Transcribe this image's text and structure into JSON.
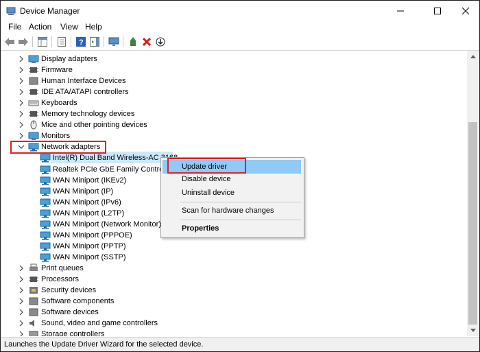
{
  "window": {
    "title": "Device Manager"
  },
  "menu": [
    "File",
    "Action",
    "View",
    "Help"
  ],
  "tree": {
    "categories": [
      {
        "label": "Display adapters",
        "icon": "display-adapter-icon"
      },
      {
        "label": "Firmware",
        "icon": "firmware-icon"
      },
      {
        "label": "Human Interface Devices",
        "icon": "hid-icon"
      },
      {
        "label": "IDE ATA/ATAPI controllers",
        "icon": "ide-controller-icon"
      },
      {
        "label": "Keyboards",
        "icon": "keyboard-icon"
      },
      {
        "label": "Memory technology devices",
        "icon": "memory-icon"
      },
      {
        "label": "Mice and other pointing devices",
        "icon": "mouse-icon"
      },
      {
        "label": "Monitors",
        "icon": "monitor-icon"
      },
      {
        "label": "Network adapters",
        "icon": "network-adapter-icon",
        "expanded": true
      }
    ],
    "network_children": [
      "Intel(R) Dual Band Wireless-AC 3168",
      "Realtek PCIe GbE Family Controller",
      "WAN Miniport (IKEv2)",
      "WAN Miniport (IP)",
      "WAN Miniport (IPv6)",
      "WAN Miniport (L2TP)",
      "WAN Miniport (Network Monitor)",
      "WAN Miniport (PPPOE)",
      "WAN Miniport (PPTP)",
      "WAN Miniport (SSTP)"
    ],
    "categories_after": [
      {
        "label": "Print queues",
        "icon": "printer-icon"
      },
      {
        "label": "Processors",
        "icon": "processor-icon"
      },
      {
        "label": "Security devices",
        "icon": "security-icon"
      },
      {
        "label": "Software components",
        "icon": "software-component-icon"
      },
      {
        "label": "Software devices",
        "icon": "software-device-icon"
      },
      {
        "label": "Sound, video and game controllers",
        "icon": "sound-icon"
      },
      {
        "label": "Storage controllers",
        "icon": "storage-icon"
      }
    ]
  },
  "context_menu": {
    "update": "Update driver",
    "disable": "Disable device",
    "uninstall": "Uninstall device",
    "scan": "Scan for hardware changes",
    "properties": "Properties"
  },
  "status": "Launches the Update Driver Wizard for the selected device.",
  "colors": {
    "highlight": "#91c9f7",
    "selection": "#cce8ff",
    "annotation": "#e0201f"
  }
}
